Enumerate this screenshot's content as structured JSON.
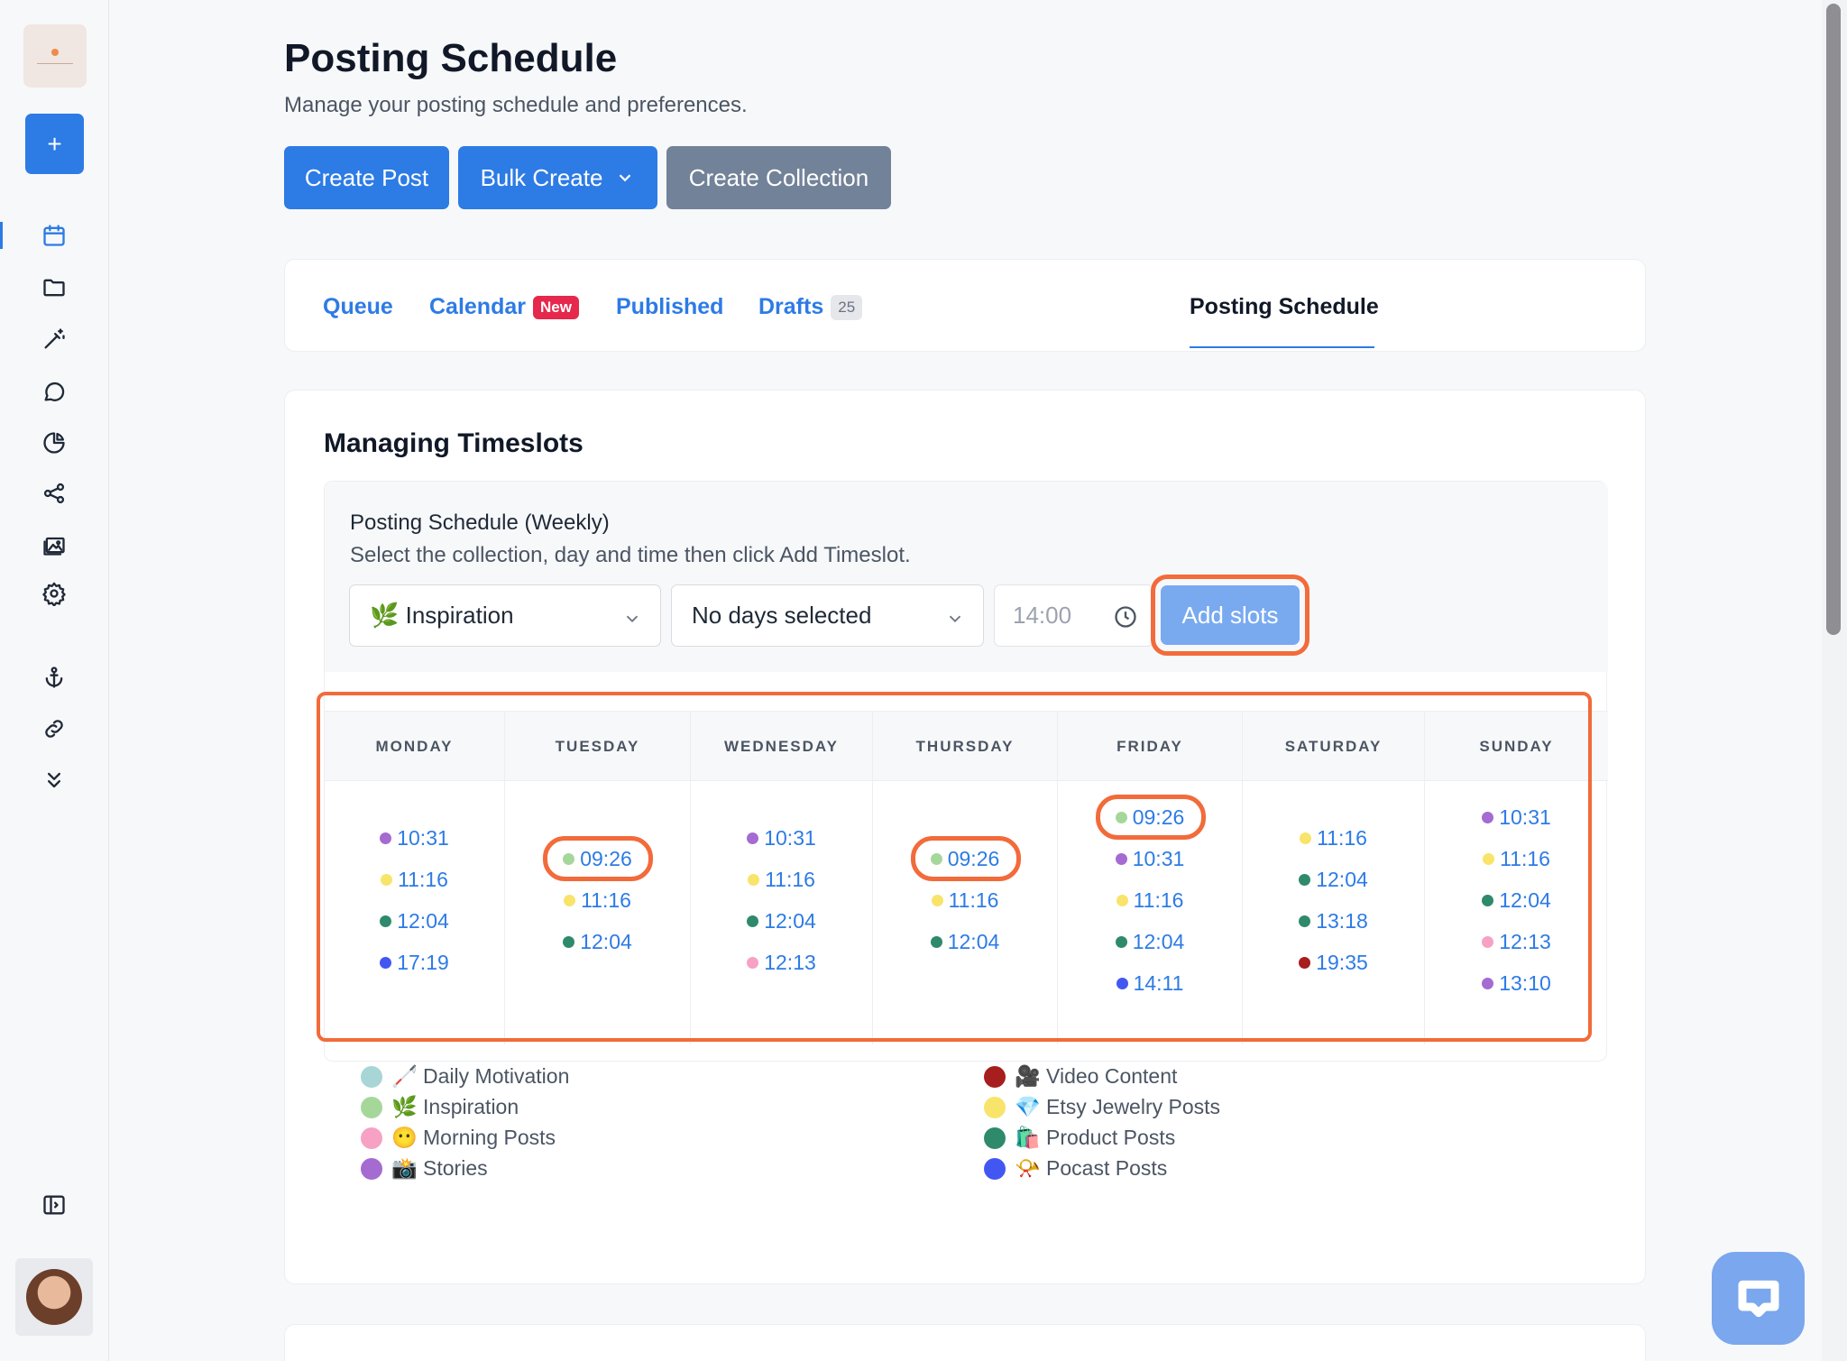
{
  "sidebar": {
    "new_label": "+",
    "nav_icons": [
      "calendar-icon",
      "folder-icon",
      "magic-wand-icon",
      "chat-icon",
      "pie-chart-icon",
      "share-icon",
      "gallery-icon",
      "gear-icon",
      "anchor-icon",
      "link-icon",
      "chevrons-down-icon",
      "sidebar-toggle-icon"
    ]
  },
  "header": {
    "title": "Posting Schedule",
    "subtitle": "Manage your posting schedule and preferences."
  },
  "actions": {
    "create_post": "Create Post",
    "bulk_create": "Bulk Create",
    "create_collection": "Create Collection"
  },
  "tabs": [
    {
      "label": "Queue"
    },
    {
      "label": "Calendar",
      "badge": "New"
    },
    {
      "label": "Published"
    },
    {
      "label": "Drafts",
      "badge": "25"
    },
    {
      "label": "Posting Schedule",
      "active": true
    }
  ],
  "timeslots": {
    "title": "Managing Timeslots",
    "form_label": "Posting Schedule (Weekly)",
    "form_help": "Select the collection, day and time then click Add Timeslot.",
    "collection_value": "🌿 Inspiration",
    "days_value": "No days selected",
    "time_placeholder": "14:00",
    "add_button": "Add slots"
  },
  "colors": {
    "accent": "#2d7be5",
    "highlight": "#f26b3a",
    "daily_motivation": "#a8d5d6",
    "inspiration": "#a6d79a",
    "morning_posts": "#f7a1c4",
    "stories": "#a46bd1",
    "video_content": "#a61e1e",
    "etsy_jewelry": "#f8e46a",
    "product_posts": "#2f8a6b",
    "podcast_posts": "#4257f2"
  },
  "schedule": {
    "days": [
      {
        "name": "MONDAY",
        "slots": [
          {
            "time": "10:31",
            "color": "#a46bd1"
          },
          {
            "time": "11:16",
            "color": "#f8e46a"
          },
          {
            "time": "12:04",
            "color": "#2f8a6b"
          },
          {
            "time": "17:19",
            "color": "#4257f2"
          }
        ]
      },
      {
        "name": "TUESDAY",
        "slots": [
          {
            "time": "09:26",
            "color": "#a6d79a"
          },
          {
            "time": "11:16",
            "color": "#f8e46a"
          },
          {
            "time": "12:04",
            "color": "#2f8a6b"
          }
        ]
      },
      {
        "name": "WEDNESDAY",
        "slots": [
          {
            "time": "10:31",
            "color": "#a46bd1"
          },
          {
            "time": "11:16",
            "color": "#f8e46a"
          },
          {
            "time": "12:04",
            "color": "#2f8a6b"
          },
          {
            "time": "12:13",
            "color": "#f7a1c4"
          }
        ]
      },
      {
        "name": "THURSDAY",
        "slots": [
          {
            "time": "09:26",
            "color": "#a6d79a"
          },
          {
            "time": "11:16",
            "color": "#f8e46a"
          },
          {
            "time": "12:04",
            "color": "#2f8a6b"
          }
        ]
      },
      {
        "name": "FRIDAY",
        "slots": [
          {
            "time": "09:26",
            "color": "#a6d79a"
          },
          {
            "time": "10:31",
            "color": "#a46bd1"
          },
          {
            "time": "11:16",
            "color": "#f8e46a"
          },
          {
            "time": "12:04",
            "color": "#2f8a6b"
          },
          {
            "time": "14:11",
            "color": "#4257f2"
          }
        ]
      },
      {
        "name": "SATURDAY",
        "slots": [
          {
            "time": "11:16",
            "color": "#f8e46a"
          },
          {
            "time": "12:04",
            "color": "#2f8a6b"
          },
          {
            "time": "13:18",
            "color": "#2f8a6b"
          },
          {
            "time": "19:35",
            "color": "#a61e1e"
          }
        ]
      },
      {
        "name": "SUNDAY",
        "slots": [
          {
            "time": "10:31",
            "color": "#a46bd1"
          },
          {
            "time": "11:16",
            "color": "#f8e46a"
          },
          {
            "time": "12:04",
            "color": "#2f8a6b"
          },
          {
            "time": "12:13",
            "color": "#f7a1c4"
          },
          {
            "time": "13:10",
            "color": "#a46bd1"
          }
        ]
      }
    ]
  },
  "legend": [
    {
      "label": "🦯 Daily Motivation",
      "color": "#a8d5d6"
    },
    {
      "label": "🌿 Inspiration",
      "color": "#a6d79a"
    },
    {
      "label": "😶 Morning Posts",
      "color": "#f7a1c4"
    },
    {
      "label": "📸 Stories",
      "color": "#a46bd1"
    },
    {
      "label": "🎥 Video Content",
      "color": "#a61e1e"
    },
    {
      "label": "💎 Etsy Jewelry Posts",
      "color": "#f8e46a"
    },
    {
      "label": "🛍️ Product Posts",
      "color": "#2f8a6b"
    },
    {
      "label": "📯 Pocast Posts",
      "color": "#4257f2"
    }
  ]
}
